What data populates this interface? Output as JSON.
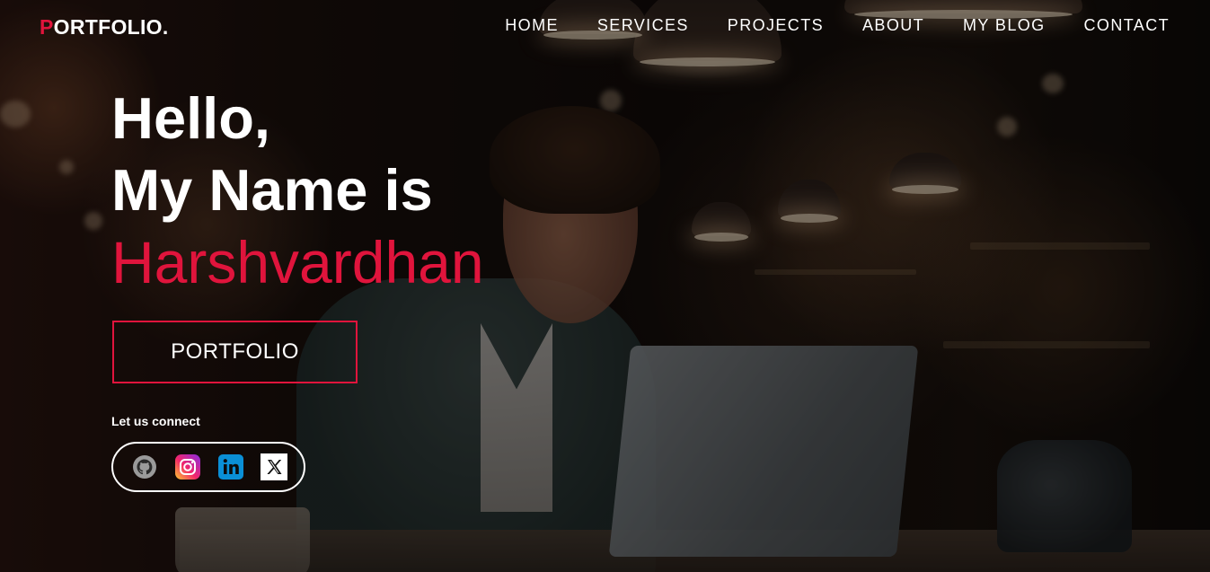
{
  "header": {
    "logo_first_letter": "P",
    "logo_rest": "ORTFOLIO.",
    "nav_items": [
      {
        "label": "HOME"
      },
      {
        "label": "SERVICES"
      },
      {
        "label": "PROJECTS"
      },
      {
        "label": "ABOUT"
      },
      {
        "label": "MY BLOG"
      },
      {
        "label": "CONTACT"
      }
    ]
  },
  "hero": {
    "greeting_line1": "Hello,",
    "greeting_line2": "My Name is",
    "name": "Harshvardhan",
    "cta_label": "PORTFOLIO",
    "connect_label": "Let us connect",
    "social_icons": [
      "github-icon",
      "instagram-icon",
      "linkedin-icon",
      "x-icon"
    ]
  },
  "colors": {
    "accent": "#e0143c",
    "text": "#ffffff"
  }
}
